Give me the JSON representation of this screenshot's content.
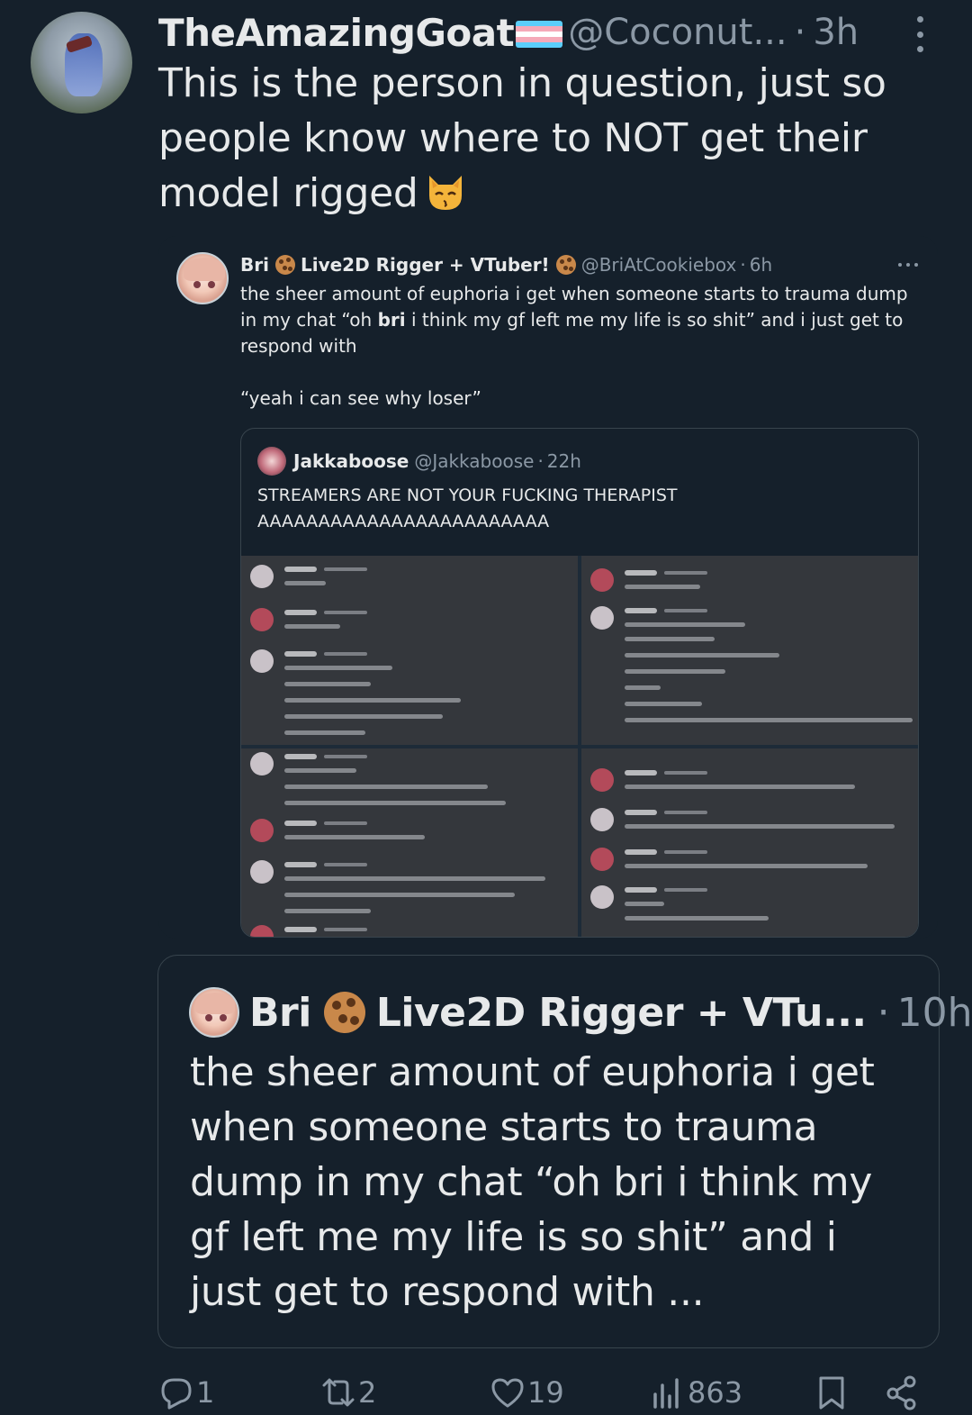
{
  "tweet": {
    "display_name": "TheAmazingGoat",
    "handle": "@Coconut...",
    "separator": "·",
    "time": "3h",
    "text": "This is the person in question, just so people know where to NOT get their model rigged",
    "flag_colors": [
      "#5bcefa",
      "#f5a9b8",
      "#ffffff",
      "#f5a9b8",
      "#5bcefa"
    ]
  },
  "quoted_tweet": {
    "name_part1": "Bri",
    "name_part2": "Live2D Rigger + VTuber!",
    "handle": "@BriAtCookiebox",
    "separator": "·",
    "time": "6h",
    "text_before_bold": "the sheer amount of euphoria i get when someone starts to trauma dump in my chat “oh ",
    "text_bold": "bri",
    "text_after_bold": " i think my gf left me my life is so shit” and i just get to respond with",
    "text_second": "“yeah i can see why loser”",
    "nested_quote": {
      "name": "Jakkaboose",
      "handle": "@Jakkaboose",
      "separator": "·",
      "time": "22h",
      "text_line1": "STREAMERS ARE NOT YOUR FUCKING THERAPIST",
      "text_line2": "AAAAAAAAAAAAAAAAAAAAAAAA"
    }
  },
  "quote_card": {
    "name_part1": "Bri",
    "name_part2": "Live2D Rigger + VTu...",
    "separator": "·",
    "time": "10h",
    "text": "the sheer amount of euphoria i get when someone starts to trauma dump in my chat “oh bri i think my gf left me my life is so shit” and i just get to respond with ..."
  },
  "actions": {
    "replies": "1",
    "reposts": "2",
    "likes": "19",
    "views": "863"
  },
  "colors": {
    "background": "#15202b",
    "secondary_text": "#8b98a5",
    "border": "#38444d"
  }
}
